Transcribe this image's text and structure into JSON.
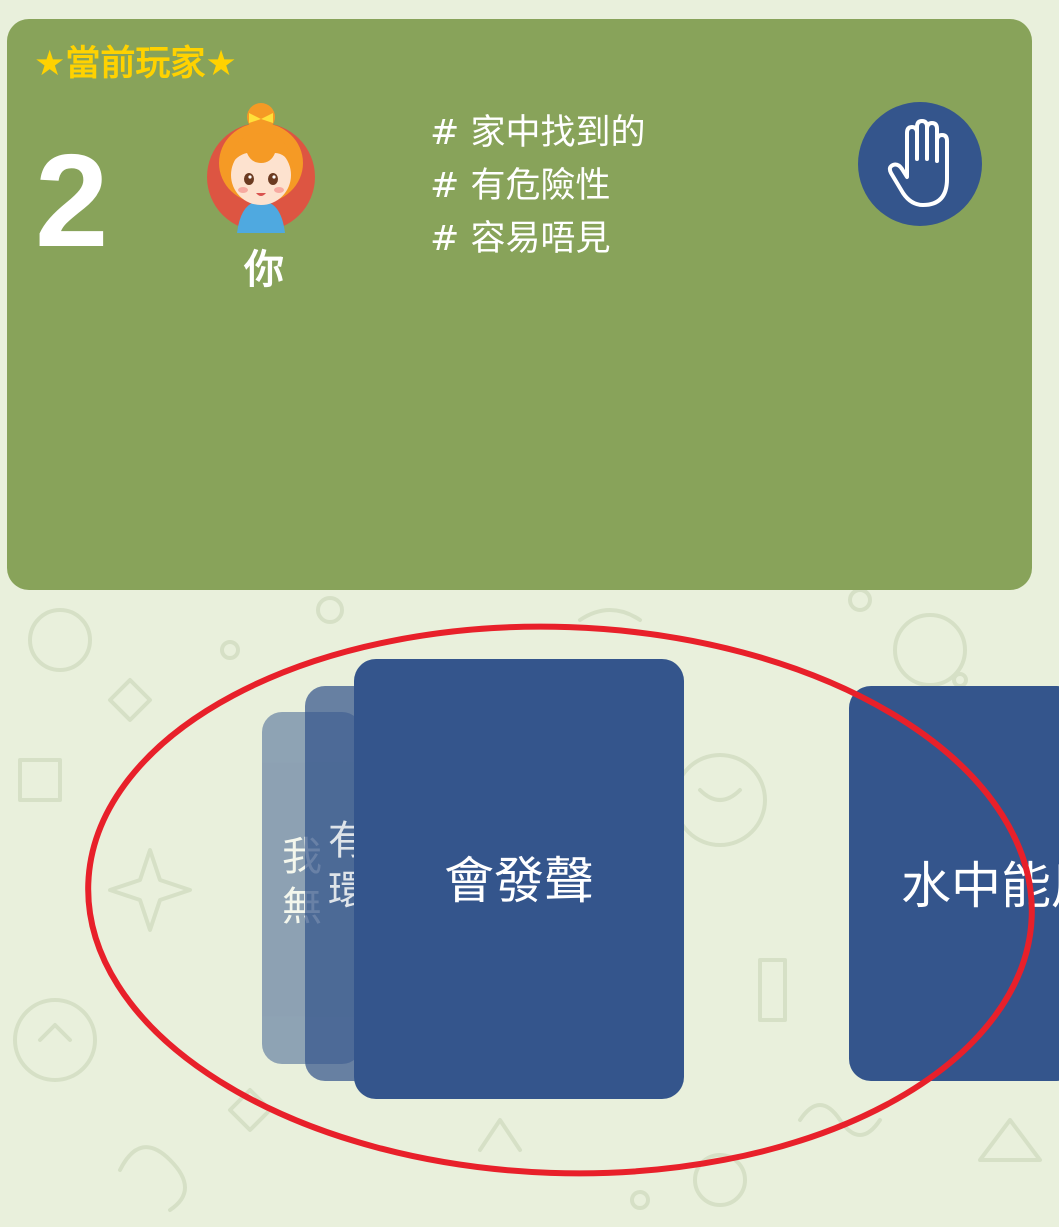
{
  "player_panel": {
    "current_label": "★當前玩家★",
    "turn_number": "2",
    "player_name": "你",
    "tags": [
      "# 家中找到的",
      "# 有危險性",
      "# 容易唔見"
    ]
  },
  "hand_button": {
    "icon": "hand-icon"
  },
  "cards": {
    "front_label": "會發聲",
    "back1_label": "有\n環",
    "back2_label": "我\n無",
    "right_label": "水中能用"
  },
  "colors": {
    "panel_green": "#88a35a",
    "card_blue": "#34558c",
    "label_yellow": "#ffd200",
    "highlight_red": "#e8202a",
    "background": "#e9f0dc"
  }
}
